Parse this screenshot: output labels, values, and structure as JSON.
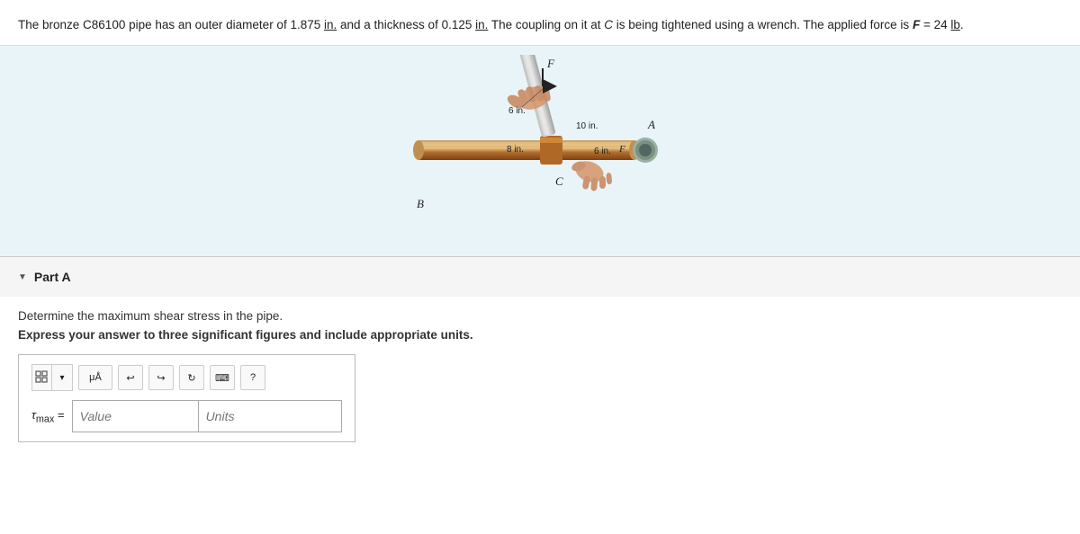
{
  "problem": {
    "text_parts": [
      "The bronze C86100 pipe has an outer diameter of 1.875 ",
      "in.",
      " and a thickness of 0.125 ",
      "in.",
      " The coupling on it at ",
      "C",
      " is being tightened using a wrench. The applied force is ",
      "F",
      " = 24 ",
      "lb",
      "."
    ],
    "full_text": "The bronze C86100 pipe has an outer diameter of 1.875 in. and a thickness of 0.125 in. The coupling on it at C is being tightened using a wrench. The applied force is F = 24 lb."
  },
  "diagram": {
    "labels": {
      "F_top": "F",
      "distance_6in_top": "6 in.",
      "distance_8in": "8 in.",
      "distance_10in": "10 in.",
      "distance_6in_right": "6 in.",
      "point_A": "A",
      "point_B": "B",
      "point_C": "C",
      "point_F_right": "F"
    }
  },
  "parts": [
    {
      "label": "Part A",
      "question_line1": "Determine the maximum shear stress in the pipe.",
      "question_line2": "Express your answer to three significant figures and include appropriate units.",
      "tau_label": "τmax =",
      "value_placeholder": "Value",
      "units_placeholder": "Units"
    }
  ],
  "toolbar": {
    "matrix_icon": "⊞",
    "mu_alpha": "μÅ",
    "undo_label": "↩",
    "redo_label": "↪",
    "refresh_label": "↻",
    "keyboard_label": "⌨",
    "help_label": "?"
  }
}
